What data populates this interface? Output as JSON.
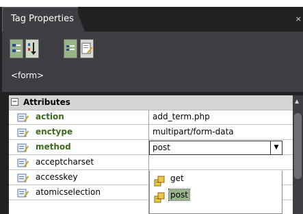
{
  "panel": {
    "title": "Tag Properties",
    "close_glyph": "×"
  },
  "toolbar": {
    "buttons": [
      {
        "icon": "category-view-icon",
        "state": "active"
      },
      {
        "icon": "alphabetical-sort-icon",
        "state": "inactive"
      },
      {
        "icon": "list-view-icon",
        "state": "active"
      },
      {
        "icon": "edit-tag-icon",
        "state": "inactive"
      }
    ]
  },
  "breadcrumb": "<form>",
  "category": {
    "expander": "−",
    "label": "Attributes"
  },
  "rows": [
    {
      "name": "action",
      "value": "add_term.php",
      "style": "bold"
    },
    {
      "name": "enctype",
      "value": "multipart/form-data",
      "style": "bold"
    },
    {
      "name": "method",
      "value": "post",
      "style": "bold"
    },
    {
      "name": "acceptcharset",
      "value": "",
      "style": "plain"
    },
    {
      "name": "accesskey",
      "value": "",
      "style": "plain"
    },
    {
      "name": "atomicselection",
      "value": "",
      "style": "plain"
    }
  ],
  "dropdown": {
    "selected": "post",
    "arrow": "▼",
    "options": [
      "get",
      "post"
    ]
  },
  "scrollbar": {
    "up_arrow": "▲"
  },
  "colors": {
    "panel_bg": "#3d3d42",
    "active_green": "#9ab48a",
    "attr_name_green": "#3b6b1c",
    "category_bg": "#d4d4d4"
  }
}
